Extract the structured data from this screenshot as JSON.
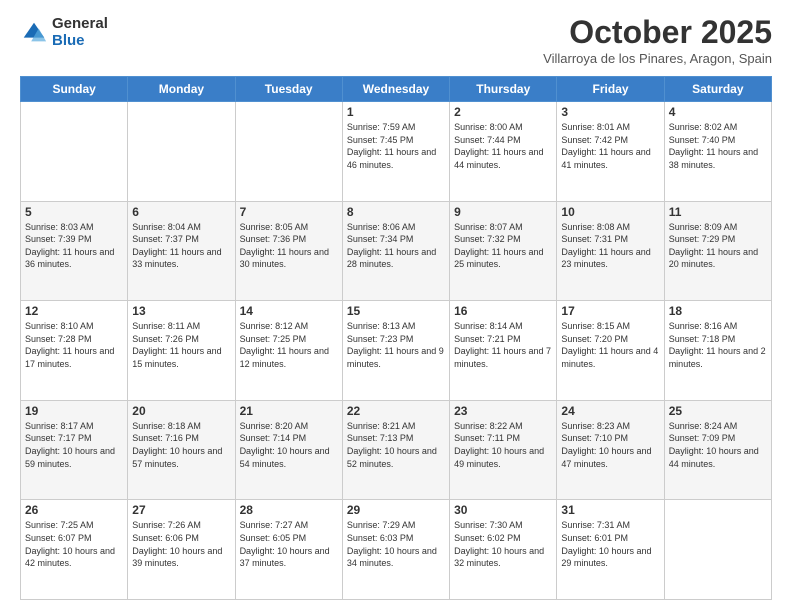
{
  "logo": {
    "general": "General",
    "blue": "Blue"
  },
  "header": {
    "month": "October 2025",
    "location": "Villarroya de los Pinares, Aragon, Spain"
  },
  "days": [
    "Sunday",
    "Monday",
    "Tuesday",
    "Wednesday",
    "Thursday",
    "Friday",
    "Saturday"
  ],
  "weeks": [
    [
      {
        "day": "",
        "info": ""
      },
      {
        "day": "",
        "info": ""
      },
      {
        "day": "",
        "info": ""
      },
      {
        "day": "1",
        "info": "Sunrise: 7:59 AM\nSunset: 7:45 PM\nDaylight: 11 hours and 46 minutes."
      },
      {
        "day": "2",
        "info": "Sunrise: 8:00 AM\nSunset: 7:44 PM\nDaylight: 11 hours and 44 minutes."
      },
      {
        "day": "3",
        "info": "Sunrise: 8:01 AM\nSunset: 7:42 PM\nDaylight: 11 hours and 41 minutes."
      },
      {
        "day": "4",
        "info": "Sunrise: 8:02 AM\nSunset: 7:40 PM\nDaylight: 11 hours and 38 minutes."
      }
    ],
    [
      {
        "day": "5",
        "info": "Sunrise: 8:03 AM\nSunset: 7:39 PM\nDaylight: 11 hours and 36 minutes."
      },
      {
        "day": "6",
        "info": "Sunrise: 8:04 AM\nSunset: 7:37 PM\nDaylight: 11 hours and 33 minutes."
      },
      {
        "day": "7",
        "info": "Sunrise: 8:05 AM\nSunset: 7:36 PM\nDaylight: 11 hours and 30 minutes."
      },
      {
        "day": "8",
        "info": "Sunrise: 8:06 AM\nSunset: 7:34 PM\nDaylight: 11 hours and 28 minutes."
      },
      {
        "day": "9",
        "info": "Sunrise: 8:07 AM\nSunset: 7:32 PM\nDaylight: 11 hours and 25 minutes."
      },
      {
        "day": "10",
        "info": "Sunrise: 8:08 AM\nSunset: 7:31 PM\nDaylight: 11 hours and 23 minutes."
      },
      {
        "day": "11",
        "info": "Sunrise: 8:09 AM\nSunset: 7:29 PM\nDaylight: 11 hours and 20 minutes."
      }
    ],
    [
      {
        "day": "12",
        "info": "Sunrise: 8:10 AM\nSunset: 7:28 PM\nDaylight: 11 hours and 17 minutes."
      },
      {
        "day": "13",
        "info": "Sunrise: 8:11 AM\nSunset: 7:26 PM\nDaylight: 11 hours and 15 minutes."
      },
      {
        "day": "14",
        "info": "Sunrise: 8:12 AM\nSunset: 7:25 PM\nDaylight: 11 hours and 12 minutes."
      },
      {
        "day": "15",
        "info": "Sunrise: 8:13 AM\nSunset: 7:23 PM\nDaylight: 11 hours and 9 minutes."
      },
      {
        "day": "16",
        "info": "Sunrise: 8:14 AM\nSunset: 7:21 PM\nDaylight: 11 hours and 7 minutes."
      },
      {
        "day": "17",
        "info": "Sunrise: 8:15 AM\nSunset: 7:20 PM\nDaylight: 11 hours and 4 minutes."
      },
      {
        "day": "18",
        "info": "Sunrise: 8:16 AM\nSunset: 7:18 PM\nDaylight: 11 hours and 2 minutes."
      }
    ],
    [
      {
        "day": "19",
        "info": "Sunrise: 8:17 AM\nSunset: 7:17 PM\nDaylight: 10 hours and 59 minutes."
      },
      {
        "day": "20",
        "info": "Sunrise: 8:18 AM\nSunset: 7:16 PM\nDaylight: 10 hours and 57 minutes."
      },
      {
        "day": "21",
        "info": "Sunrise: 8:20 AM\nSunset: 7:14 PM\nDaylight: 10 hours and 54 minutes."
      },
      {
        "day": "22",
        "info": "Sunrise: 8:21 AM\nSunset: 7:13 PM\nDaylight: 10 hours and 52 minutes."
      },
      {
        "day": "23",
        "info": "Sunrise: 8:22 AM\nSunset: 7:11 PM\nDaylight: 10 hours and 49 minutes."
      },
      {
        "day": "24",
        "info": "Sunrise: 8:23 AM\nSunset: 7:10 PM\nDaylight: 10 hours and 47 minutes."
      },
      {
        "day": "25",
        "info": "Sunrise: 8:24 AM\nSunset: 7:09 PM\nDaylight: 10 hours and 44 minutes."
      }
    ],
    [
      {
        "day": "26",
        "info": "Sunrise: 7:25 AM\nSunset: 6:07 PM\nDaylight: 10 hours and 42 minutes."
      },
      {
        "day": "27",
        "info": "Sunrise: 7:26 AM\nSunset: 6:06 PM\nDaylight: 10 hours and 39 minutes."
      },
      {
        "day": "28",
        "info": "Sunrise: 7:27 AM\nSunset: 6:05 PM\nDaylight: 10 hours and 37 minutes."
      },
      {
        "day": "29",
        "info": "Sunrise: 7:29 AM\nSunset: 6:03 PM\nDaylight: 10 hours and 34 minutes."
      },
      {
        "day": "30",
        "info": "Sunrise: 7:30 AM\nSunset: 6:02 PM\nDaylight: 10 hours and 32 minutes."
      },
      {
        "day": "31",
        "info": "Sunrise: 7:31 AM\nSunset: 6:01 PM\nDaylight: 10 hours and 29 minutes."
      },
      {
        "day": "",
        "info": ""
      }
    ]
  ]
}
